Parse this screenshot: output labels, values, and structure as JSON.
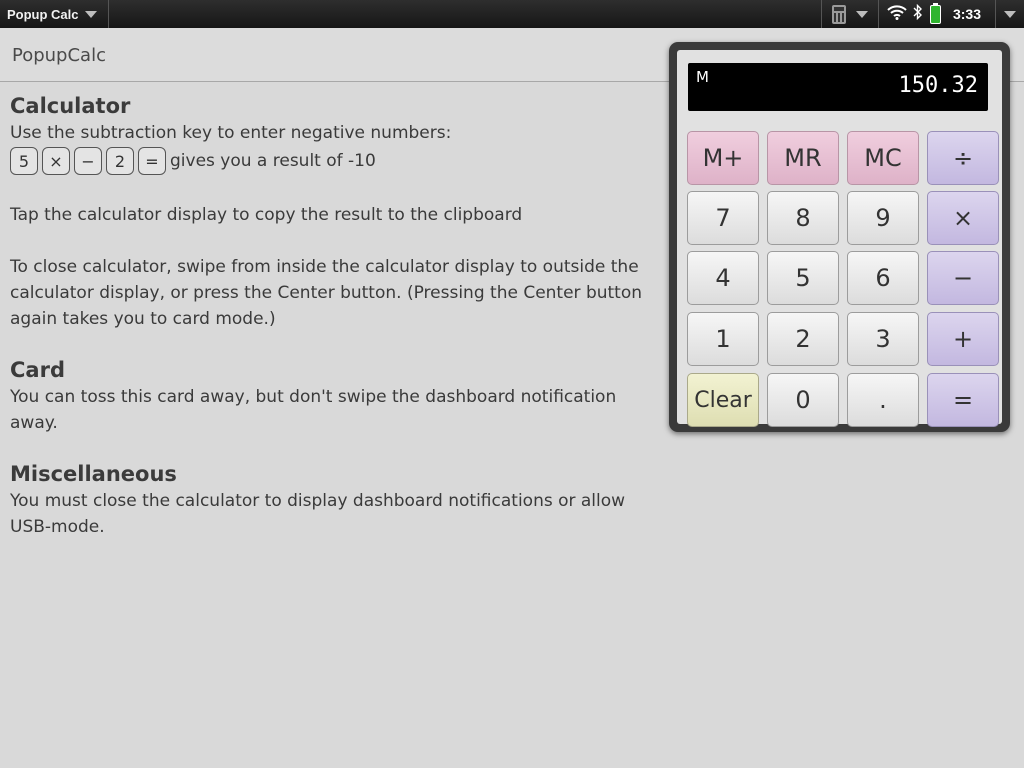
{
  "statusbar": {
    "app_title": "Popup Calc",
    "time": "3:33",
    "icons": [
      "calculator-icon",
      "wifi-icon",
      "bluetooth-icon",
      "battery-charging-icon"
    ]
  },
  "header": {
    "title": "PopupCalc"
  },
  "content": {
    "calculator": {
      "title": "Calculator",
      "intro": "Use the subtraction key to enter negative numbers:",
      "example_keys": [
        "5",
        "×",
        "−",
        "2",
        "="
      ],
      "example_tail": "gives you a result of -10",
      "copy_tip": "Tap the calculator display to copy the result to the clipboard",
      "close_tip": "To close calculator, swipe from inside the calculator display to outside the calculator display, or press the Center button. (Pressing the Center button again takes you to card mode.)"
    },
    "card": {
      "title": "Card",
      "text": "You can toss this card away, but don't swipe the dashboard notification away."
    },
    "misc": {
      "title": "Miscellaneous",
      "text": "You must close the calculator to display dashboard notifications or allow USB-mode."
    }
  },
  "calc": {
    "memory_indicator": "M",
    "display_value": "150.32",
    "colors": {
      "memory_key": "#e8c4d6",
      "operator_key": "#d1c9ea",
      "clear_key": "#ececc6",
      "digit_key": "#ececec"
    },
    "keys": {
      "mplus": "M+",
      "mr": "MR",
      "mc": "MC",
      "divide": "÷",
      "seven": "7",
      "eight": "8",
      "nine": "9",
      "multiply": "×",
      "four": "4",
      "five": "5",
      "six": "6",
      "minus": "−",
      "one": "1",
      "two": "2",
      "three": "3",
      "plus": "+",
      "clear": "Clear",
      "zero": "0",
      "decimal": ".",
      "equals": "="
    }
  }
}
